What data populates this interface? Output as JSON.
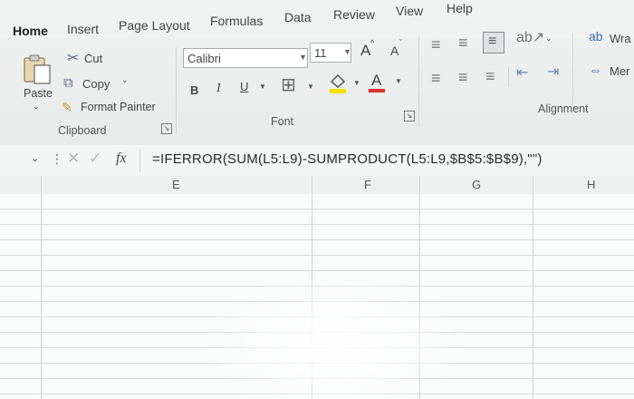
{
  "tabs": [
    "Home",
    "Insert",
    "Page Layout",
    "Formulas",
    "Data",
    "Review",
    "View",
    "Help"
  ],
  "clipboard": {
    "paste_label": "Paste",
    "cut_label": "Cut",
    "copy_label": "Copy",
    "format_painter_label": "Format Painter",
    "group_label": "Clipboard"
  },
  "font": {
    "font_name": "Calibri",
    "font_size": "11",
    "group_label": "Font",
    "bold": "B",
    "italic": "I",
    "underline": "U",
    "grow": "A",
    "shrink": "A",
    "font_color": "A"
  },
  "alignment": {
    "wrap_label": "Wra",
    "merge_label": "Mer",
    "group_label": "Alignment"
  },
  "formula_bar": {
    "fx": "fx",
    "formula": "=IFERROR(SUM(L5:L9)-SUMPRODUCT(L5:L9,$B$5:$B$9),\"\")"
  },
  "columns": [
    "E",
    "F",
    "G",
    "H"
  ],
  "colors": {
    "accent": "#2b7c4c",
    "font_color_bar": "#e03030",
    "fill_bar": "#f5e100"
  }
}
